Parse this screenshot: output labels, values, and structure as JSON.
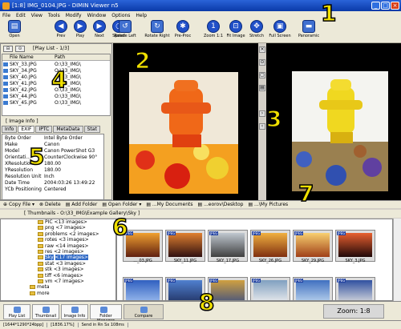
{
  "title": "[1:8] IMG_0104.JPG - DIMIN Viewer n5",
  "menu": [
    "File",
    "Edit",
    "View",
    "Tools",
    "Modify",
    "Window",
    "Options",
    "Help"
  ],
  "toolbar": [
    "Open",
    "Prev",
    "Play",
    "Next",
    "Speed",
    "Rotate Left",
    "Rotate Right",
    "Pre-Proc",
    "Zoom 1:1",
    "Fit Image",
    "Stretch",
    "Full Screen",
    "Panoramic"
  ],
  "playlist": {
    "header": "[Play List - 1/3]",
    "col_name": "File Name",
    "col_path": "Path",
    "rows": [
      [
        "SKY_33.JPG",
        "O:\\33_IMG\\"
      ],
      [
        "SKY_34.JPG",
        "O:\\33_IMG\\"
      ],
      [
        "SKY_40.JPG",
        "O:\\33_IMG\\"
      ],
      [
        "SKY_41.JPG",
        "O:\\33_IMG\\"
      ],
      [
        "SKY_42.JPG",
        "O:\\33_IMG\\"
      ],
      [
        "SKY_44.JPG",
        "O:\\33_IMG\\"
      ],
      [
        "SKY_45.JPG",
        "O:\\33_IMG\\"
      ]
    ]
  },
  "info": {
    "title": "[ Image Info ]",
    "tabs": [
      "Info",
      "EXIF",
      "IPTC",
      "MetaData",
      "Stat"
    ],
    "rows": [
      [
        "Byte Order",
        "Intel Byte Order"
      ],
      [
        "Make",
        "Canon"
      ],
      [
        "Model",
        "Canon PowerShot G3"
      ],
      [
        "Orientati...",
        "CounterClockwise 90°"
      ],
      [
        "XResolution",
        "180.00"
      ],
      [
        "YResolution",
        "180.00"
      ],
      [
        "Resolution Unit",
        "Inch"
      ],
      [
        "Date Time",
        "2004:03:26 13:49:22"
      ],
      [
        "YCb Positioning",
        "Centered"
      ]
    ]
  },
  "actions": [
    "Copy File",
    "Delete",
    "Add Folder",
    "Open Folder",
    "...My Documents",
    "...eorov\\Desktop",
    "...\\My Pictures"
  ],
  "thumbs_header": "[ Thumbnails - O:\\33_IMG\\Example Gallery\\Sky ]",
  "tree": [
    [
      "PIC",
      "<13 images>"
    ],
    [
      "png",
      "<7 images>"
    ],
    [
      "problems",
      "<2 images>"
    ],
    [
      "rotes",
      "<3 images>"
    ],
    [
      "raw",
      "<14 images>"
    ],
    [
      "res",
      "<2 images>"
    ],
    [
      "Sky",
      "<17 images>"
    ],
    [
      "stat",
      "<3 images>"
    ],
    [
      "stk",
      "<3 images>"
    ],
    [
      "tiff",
      "<6 images>"
    ],
    [
      "vm",
      "<7 images>"
    ],
    [
      "meta",
      ""
    ],
    [
      "more",
      ""
    ]
  ],
  "thumbnails": [
    "..._03.JPG",
    "SKY_11.JPG",
    "SKY_17.JPG",
    "SKY_26.JPG",
    "SKY_29.JPG",
    "SKY_3.JPG",
    "",
    "",
    "",
    "",
    "",
    ""
  ],
  "bottom_tabs": [
    "Play List",
    "Thumbnail",
    "Image Info",
    "Folder Manager",
    "Compare"
  ],
  "zoom": "Zoom: 1:8",
  "status": [
    "[1644*1290*24bpp]",
    "[1836.17%]",
    "Send in Rn Sx 108ms"
  ],
  "numbers": [
    "1",
    "2",
    "3",
    "4",
    "5",
    "6",
    "7",
    "8"
  ]
}
